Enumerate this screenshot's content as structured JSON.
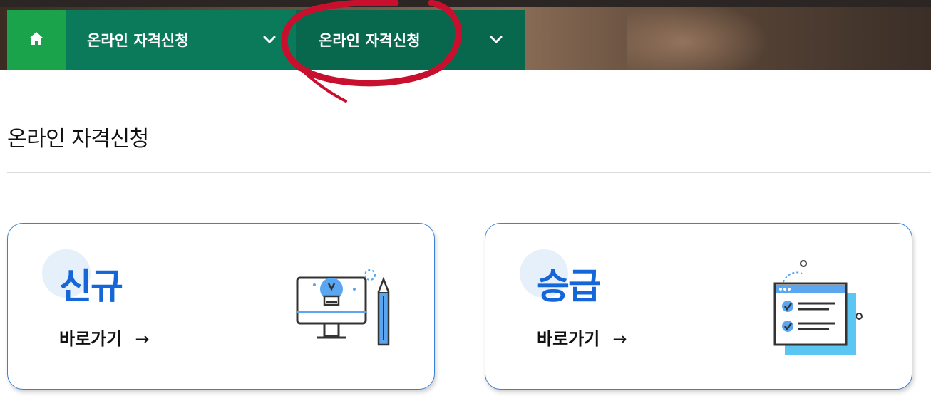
{
  "nav": {
    "home_icon": "home-icon",
    "item1": {
      "label": "온라인 자격신청",
      "icon": "chevron-down-icon"
    },
    "item2": {
      "label": "온라인 자격신청",
      "icon": "chevron-down-icon"
    }
  },
  "page": {
    "title": "온라인 자격신청"
  },
  "cards": [
    {
      "title": "신규",
      "link_label": "바로가기",
      "arrow": "→",
      "icon": "lightbulb-monitor-pencil-icon"
    },
    {
      "title": "승급",
      "link_label": "바로가기",
      "arrow": "→",
      "icon": "checklist-icon"
    }
  ],
  "colors": {
    "home_bg": "#1aa34a",
    "nav1_bg": "#0a7a5a",
    "nav2_bg": "#08684d",
    "card_border": "#3b82d6",
    "card_title": "#1566d8",
    "annotation_red": "#c8102e"
  }
}
